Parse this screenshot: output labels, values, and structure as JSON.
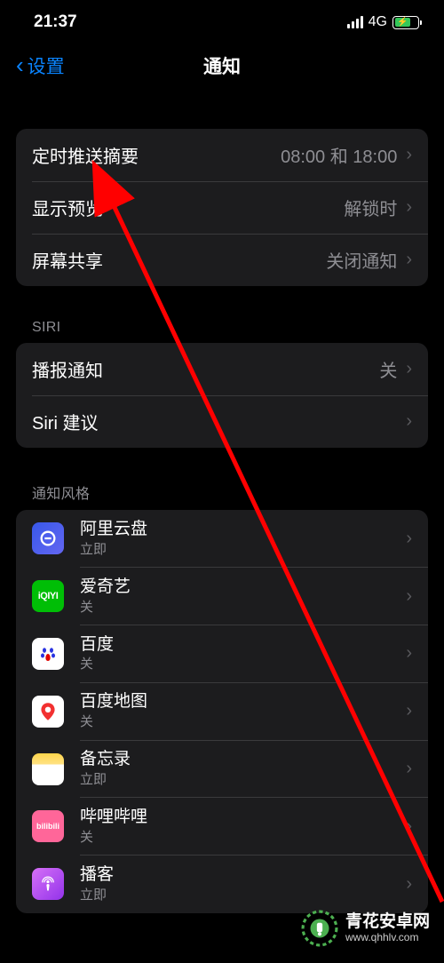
{
  "status": {
    "time": "21:37",
    "network": "4G"
  },
  "nav": {
    "back": "设置",
    "title": "通知"
  },
  "group1": {
    "scheduled_summary": {
      "label": "定时推送摘要",
      "value": "08:00 和 18:00"
    },
    "show_preview": {
      "label": "显示预览",
      "value": "解锁时"
    },
    "screen_sharing": {
      "label": "屏幕共享",
      "value": "关闭通知"
    }
  },
  "siri_header": "SIRI",
  "group2": {
    "announce": {
      "label": "播报通知",
      "value": "关"
    },
    "suggestions": {
      "label": "Siri 建议"
    }
  },
  "style_header": "通知风格",
  "apps": [
    {
      "name": "阿里云盘",
      "sub": "立即",
      "icon": "aliyun"
    },
    {
      "name": "爱奇艺",
      "sub": "关",
      "icon": "iqiyi"
    },
    {
      "name": "百度",
      "sub": "关",
      "icon": "baidu"
    },
    {
      "name": "百度地图",
      "sub": "关",
      "icon": "baidu-map"
    },
    {
      "name": "备忘录",
      "sub": "立即",
      "icon": "notes"
    },
    {
      "name": "哔哩哔哩",
      "sub": "关",
      "icon": "bilibili"
    },
    {
      "name": "播客",
      "sub": "立即",
      "icon": "podcast"
    }
  ],
  "watermark": {
    "title": "青花安卓网",
    "url": "www.qhhlv.com"
  }
}
